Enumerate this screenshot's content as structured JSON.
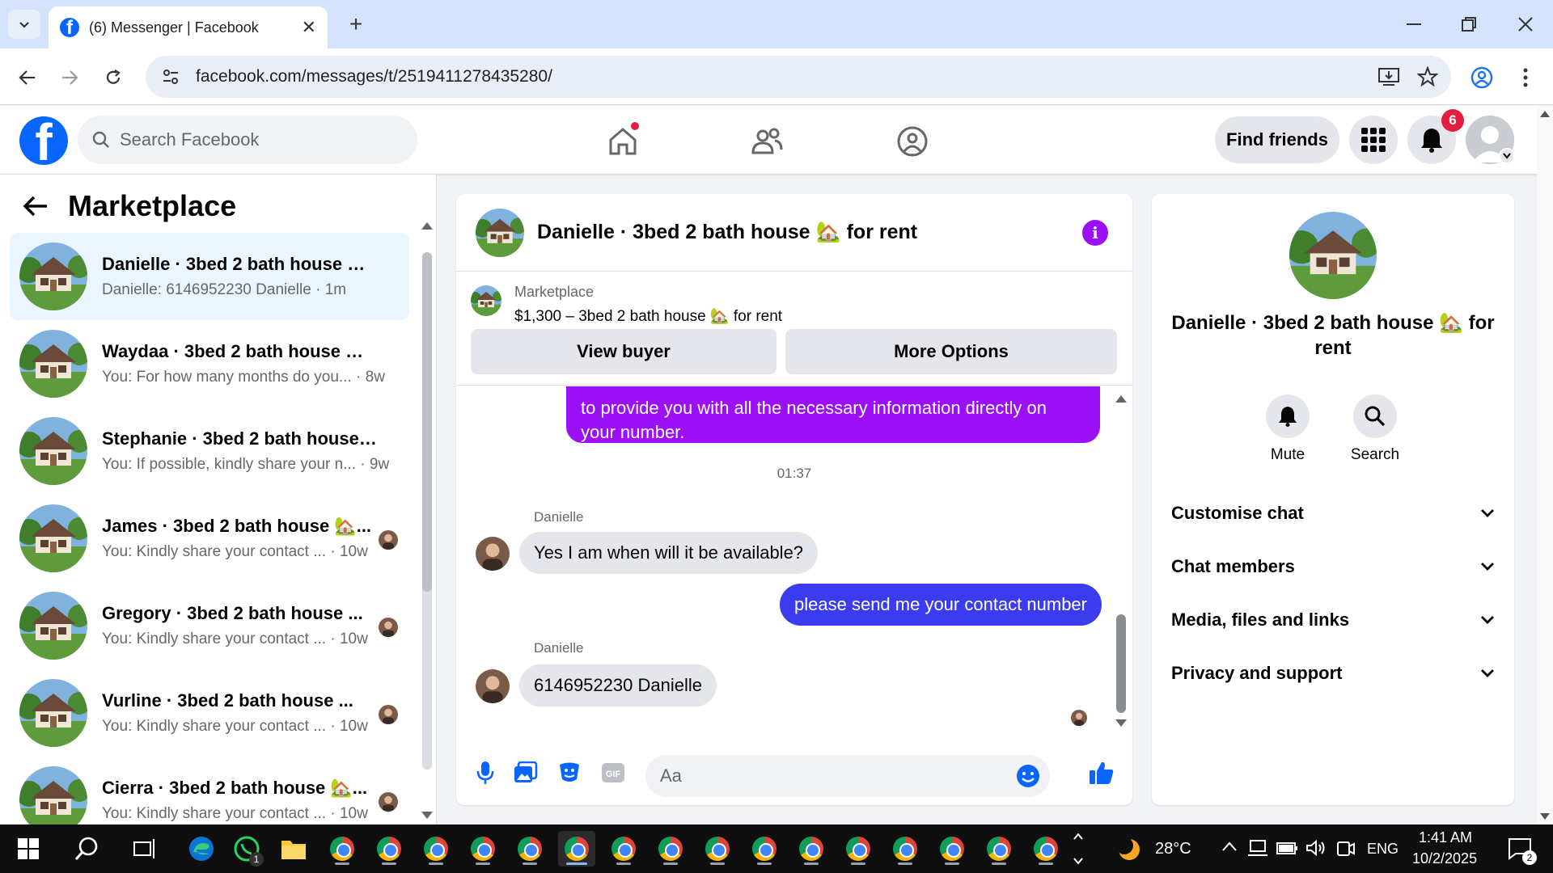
{
  "browser": {
    "tab_title": "(6) Messenger | Facebook",
    "url": "facebook.com/messages/t/2519411278435280/"
  },
  "header": {
    "search_placeholder": "Search Facebook",
    "find_friends_label": "Find friends",
    "notification_count": "6"
  },
  "left_panel": {
    "title": "Marketplace",
    "conversations": [
      {
        "name": "Danielle · 3bed 2 bath house 🏡 ...",
        "preview": "Danielle: 6146952230 Danielle · 1m"
      },
      {
        "name": "Waydaa · 3bed 2 bath house 🏡 ...",
        "preview": "You: For how many months do you... · 8w"
      },
      {
        "name": "Stephanie · 3bed 2 bath house ...",
        "preview": "You: If possible, kindly share your n... · 9w"
      },
      {
        "name": "James · 3bed 2 bath house 🏡...",
        "preview": "You: Kindly share your contact ... · 10w"
      },
      {
        "name": "Gregory · 3bed 2 bath house ...",
        "preview": "You: Kindly share your contact ... · 10w"
      },
      {
        "name": "Vurline · 3bed 2 bath house ...",
        "preview": "You: Kindly share your contact ... · 10w"
      },
      {
        "name": "Cierra · 3bed 2 bath house 🏡...",
        "preview": "You: Kindly share your contact ... · 10w"
      }
    ]
  },
  "chat": {
    "title": "Danielle · 3bed 2 bath house 🏡 for rent",
    "marketplace_label": "Marketplace",
    "listing_title": "$1,300 – 3bed 2 bath house 🏡 for rent",
    "view_buyer_label": "View buyer",
    "more_options_label": "More Options",
    "partial_message": "to provide you with all the necessary information directly on your number.",
    "timestamp": "01:37",
    "sender_name": "Danielle",
    "msg_in_1": "Yes I am when will it be available?",
    "msg_out_1": "please send me your contact number",
    "msg_in_2": "6146952230 Danielle",
    "composer_placeholder": "Aa"
  },
  "right_panel": {
    "name": "Danielle · 3bed 2 bath house 🏡 for rent",
    "mute_label": "Mute",
    "search_label": "Search",
    "sections": [
      "Customise chat",
      "Chat members",
      "Media, files and links",
      "Privacy and support"
    ]
  },
  "taskbar": {
    "temperature": "28°C",
    "language": "ENG",
    "time": "1:41 AM",
    "date": "10/2/2025",
    "whatsapp_badge": "1",
    "notification_badge": "2"
  },
  "colors": {
    "fb_blue": "#0866ff",
    "purple_bubble": "#9b10f5",
    "blue_bubble": "#3b3bef",
    "active_conv_bg": "#ebf5ff"
  }
}
